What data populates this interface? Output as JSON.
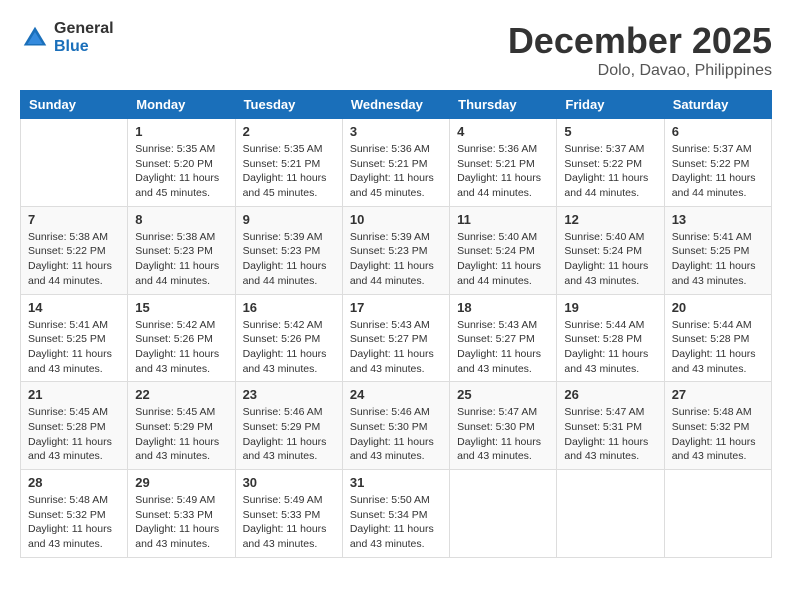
{
  "header": {
    "logo_general": "General",
    "logo_blue": "Blue",
    "month": "December 2025",
    "location": "Dolo, Davao, Philippines"
  },
  "weekdays": [
    "Sunday",
    "Monday",
    "Tuesday",
    "Wednesday",
    "Thursday",
    "Friday",
    "Saturday"
  ],
  "weeks": [
    [
      {
        "day": "",
        "sunrise": "",
        "sunset": "",
        "daylight": ""
      },
      {
        "day": "1",
        "sunrise": "Sunrise: 5:35 AM",
        "sunset": "Sunset: 5:20 PM",
        "daylight": "Daylight: 11 hours and 45 minutes."
      },
      {
        "day": "2",
        "sunrise": "Sunrise: 5:35 AM",
        "sunset": "Sunset: 5:21 PM",
        "daylight": "Daylight: 11 hours and 45 minutes."
      },
      {
        "day": "3",
        "sunrise": "Sunrise: 5:36 AM",
        "sunset": "Sunset: 5:21 PM",
        "daylight": "Daylight: 11 hours and 45 minutes."
      },
      {
        "day": "4",
        "sunrise": "Sunrise: 5:36 AM",
        "sunset": "Sunset: 5:21 PM",
        "daylight": "Daylight: 11 hours and 44 minutes."
      },
      {
        "day": "5",
        "sunrise": "Sunrise: 5:37 AM",
        "sunset": "Sunset: 5:22 PM",
        "daylight": "Daylight: 11 hours and 44 minutes."
      },
      {
        "day": "6",
        "sunrise": "Sunrise: 5:37 AM",
        "sunset": "Sunset: 5:22 PM",
        "daylight": "Daylight: 11 hours and 44 minutes."
      }
    ],
    [
      {
        "day": "7",
        "sunrise": "Sunrise: 5:38 AM",
        "sunset": "Sunset: 5:22 PM",
        "daylight": "Daylight: 11 hours and 44 minutes."
      },
      {
        "day": "8",
        "sunrise": "Sunrise: 5:38 AM",
        "sunset": "Sunset: 5:23 PM",
        "daylight": "Daylight: 11 hours and 44 minutes."
      },
      {
        "day": "9",
        "sunrise": "Sunrise: 5:39 AM",
        "sunset": "Sunset: 5:23 PM",
        "daylight": "Daylight: 11 hours and 44 minutes."
      },
      {
        "day": "10",
        "sunrise": "Sunrise: 5:39 AM",
        "sunset": "Sunset: 5:23 PM",
        "daylight": "Daylight: 11 hours and 44 minutes."
      },
      {
        "day": "11",
        "sunrise": "Sunrise: 5:40 AM",
        "sunset": "Sunset: 5:24 PM",
        "daylight": "Daylight: 11 hours and 44 minutes."
      },
      {
        "day": "12",
        "sunrise": "Sunrise: 5:40 AM",
        "sunset": "Sunset: 5:24 PM",
        "daylight": "Daylight: 11 hours and 43 minutes."
      },
      {
        "day": "13",
        "sunrise": "Sunrise: 5:41 AM",
        "sunset": "Sunset: 5:25 PM",
        "daylight": "Daylight: 11 hours and 43 minutes."
      }
    ],
    [
      {
        "day": "14",
        "sunrise": "Sunrise: 5:41 AM",
        "sunset": "Sunset: 5:25 PM",
        "daylight": "Daylight: 11 hours and 43 minutes."
      },
      {
        "day": "15",
        "sunrise": "Sunrise: 5:42 AM",
        "sunset": "Sunset: 5:26 PM",
        "daylight": "Daylight: 11 hours and 43 minutes."
      },
      {
        "day": "16",
        "sunrise": "Sunrise: 5:42 AM",
        "sunset": "Sunset: 5:26 PM",
        "daylight": "Daylight: 11 hours and 43 minutes."
      },
      {
        "day": "17",
        "sunrise": "Sunrise: 5:43 AM",
        "sunset": "Sunset: 5:27 PM",
        "daylight": "Daylight: 11 hours and 43 minutes."
      },
      {
        "day": "18",
        "sunrise": "Sunrise: 5:43 AM",
        "sunset": "Sunset: 5:27 PM",
        "daylight": "Daylight: 11 hours and 43 minutes."
      },
      {
        "day": "19",
        "sunrise": "Sunrise: 5:44 AM",
        "sunset": "Sunset: 5:28 PM",
        "daylight": "Daylight: 11 hours and 43 minutes."
      },
      {
        "day": "20",
        "sunrise": "Sunrise: 5:44 AM",
        "sunset": "Sunset: 5:28 PM",
        "daylight": "Daylight: 11 hours and 43 minutes."
      }
    ],
    [
      {
        "day": "21",
        "sunrise": "Sunrise: 5:45 AM",
        "sunset": "Sunset: 5:28 PM",
        "daylight": "Daylight: 11 hours and 43 minutes."
      },
      {
        "day": "22",
        "sunrise": "Sunrise: 5:45 AM",
        "sunset": "Sunset: 5:29 PM",
        "daylight": "Daylight: 11 hours and 43 minutes."
      },
      {
        "day": "23",
        "sunrise": "Sunrise: 5:46 AM",
        "sunset": "Sunset: 5:29 PM",
        "daylight": "Daylight: 11 hours and 43 minutes."
      },
      {
        "day": "24",
        "sunrise": "Sunrise: 5:46 AM",
        "sunset": "Sunset: 5:30 PM",
        "daylight": "Daylight: 11 hours and 43 minutes."
      },
      {
        "day": "25",
        "sunrise": "Sunrise: 5:47 AM",
        "sunset": "Sunset: 5:30 PM",
        "daylight": "Daylight: 11 hours and 43 minutes."
      },
      {
        "day": "26",
        "sunrise": "Sunrise: 5:47 AM",
        "sunset": "Sunset: 5:31 PM",
        "daylight": "Daylight: 11 hours and 43 minutes."
      },
      {
        "day": "27",
        "sunrise": "Sunrise: 5:48 AM",
        "sunset": "Sunset: 5:32 PM",
        "daylight": "Daylight: 11 hours and 43 minutes."
      }
    ],
    [
      {
        "day": "28",
        "sunrise": "Sunrise: 5:48 AM",
        "sunset": "Sunset: 5:32 PM",
        "daylight": "Daylight: 11 hours and 43 minutes."
      },
      {
        "day": "29",
        "sunrise": "Sunrise: 5:49 AM",
        "sunset": "Sunset: 5:33 PM",
        "daylight": "Daylight: 11 hours and 43 minutes."
      },
      {
        "day": "30",
        "sunrise": "Sunrise: 5:49 AM",
        "sunset": "Sunset: 5:33 PM",
        "daylight": "Daylight: 11 hours and 43 minutes."
      },
      {
        "day": "31",
        "sunrise": "Sunrise: 5:50 AM",
        "sunset": "Sunset: 5:34 PM",
        "daylight": "Daylight: 11 hours and 43 minutes."
      },
      {
        "day": "",
        "sunrise": "",
        "sunset": "",
        "daylight": ""
      },
      {
        "day": "",
        "sunrise": "",
        "sunset": "",
        "daylight": ""
      },
      {
        "day": "",
        "sunrise": "",
        "sunset": "",
        "daylight": ""
      }
    ]
  ]
}
